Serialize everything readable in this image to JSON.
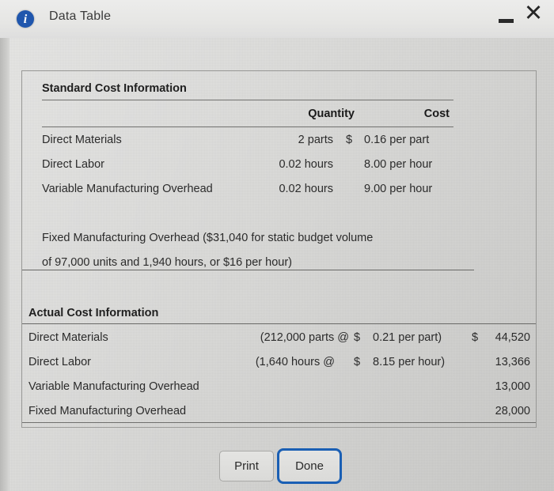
{
  "window": {
    "title": "Data Table",
    "info_icon": "i",
    "minimize_label": "—",
    "close_label": "×"
  },
  "standard_section": {
    "heading": "Standard Cost Information",
    "columns": {
      "quantity": "Quantity",
      "cost": "Cost"
    },
    "rows": [
      {
        "label": "Direct Materials",
        "quantity": "2 parts",
        "currency": "$",
        "cost": "0.16 per part"
      },
      {
        "label": "Direct Labor",
        "quantity": "0.02 hours",
        "currency": "",
        "cost": "8.00 per hour"
      },
      {
        "label": "Variable Manufacturing Overhead",
        "quantity": "0.02 hours",
        "currency": "",
        "cost": "9.00 per hour"
      }
    ],
    "fixed_overhead_note_line1": "Fixed Manufacturing Overhead ($31,040 for static budget volume",
    "fixed_overhead_note_line2": "of 97,000 units and 1,940 hours, or $16 per hour)"
  },
  "actual_section": {
    "heading": "Actual Cost Information",
    "rows": [
      {
        "label": "Direct Materials",
        "quantity": "(212,000 parts @",
        "rate_currency": "$",
        "rate": "0.21 per part)",
        "amount_currency": "$",
        "amount": "44,520"
      },
      {
        "label": "Direct Labor",
        "quantity": "(1,640 hours @",
        "rate_currency": "$",
        "rate": "8.15 per hour)",
        "amount_currency": "",
        "amount": "13,366"
      },
      {
        "label": "Variable Manufacturing Overhead",
        "quantity": "",
        "rate_currency": "",
        "rate": "",
        "amount_currency": "",
        "amount": "13,000"
      },
      {
        "label": "Fixed Manufacturing Overhead",
        "quantity": "",
        "rate_currency": "",
        "rate": "",
        "amount_currency": "",
        "amount": "28,000"
      }
    ]
  },
  "footer": {
    "print_label": "Print",
    "done_label": "Done"
  },
  "colors": {
    "accent_blue": "#1a5fb4",
    "info_blue": "#1f56ad",
    "background": "#dcdcda",
    "text": "#2b2b2b"
  }
}
